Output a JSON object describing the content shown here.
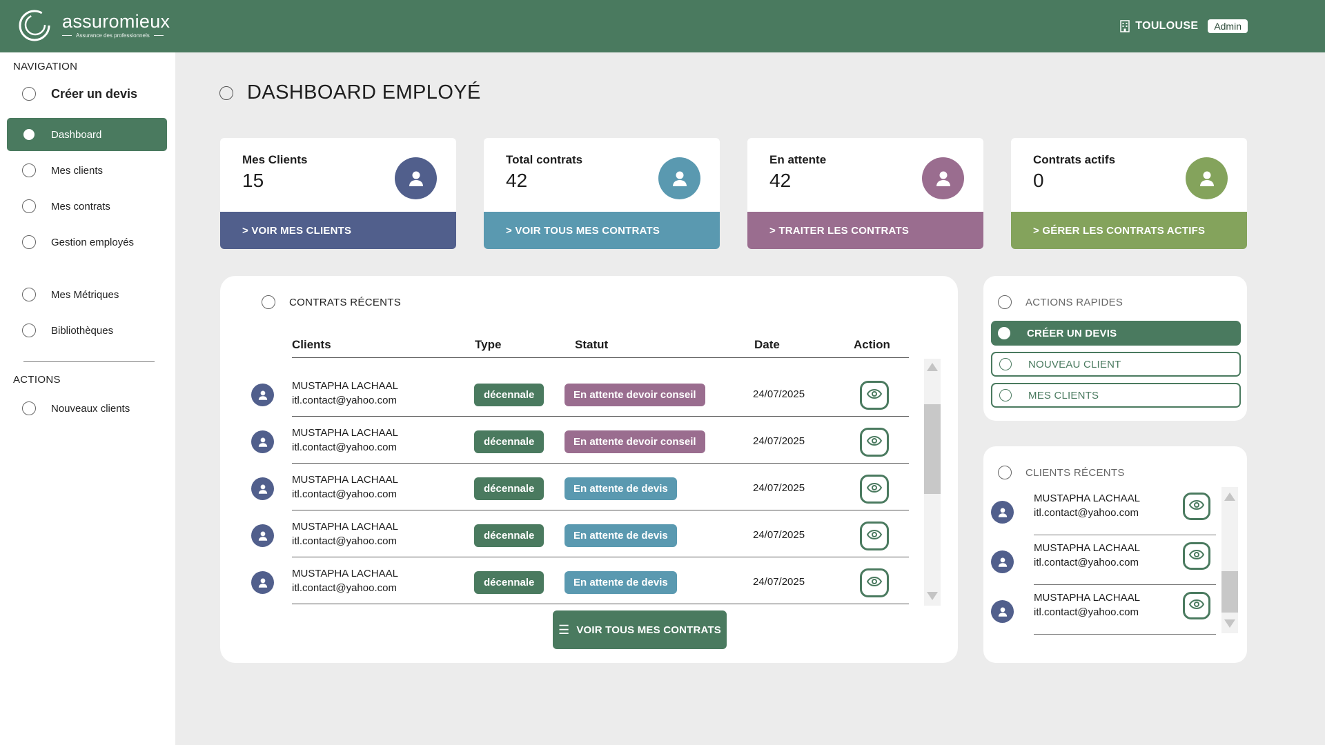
{
  "header": {
    "logo_name": "assuromieux",
    "logo_tagline": "Assurance des professionnels",
    "city": "TOULOUSE",
    "role": "Admin"
  },
  "sidebar": {
    "nav_title": "NAVIGATION",
    "items": [
      {
        "label": "Créer un devis"
      },
      {
        "label": "Dashboard"
      },
      {
        "label": "Mes clients"
      },
      {
        "label": "Mes contrats"
      },
      {
        "label": "Gestion employés"
      },
      {
        "label": "Mes Métriques"
      },
      {
        "label": "Bibliothèques"
      }
    ],
    "actions_title": "ACTIONS",
    "actions": [
      {
        "label": "Nouveaux clients"
      }
    ]
  },
  "main": {
    "title": "DASHBOARD EMPLOYÉ",
    "cards": [
      {
        "label": "Mes Clients",
        "value": "15",
        "link": "> VOIR MES CLIENTS",
        "color": "#515f8c"
      },
      {
        "label": "Total contrats",
        "value": "42",
        "link": "> VOIR TOUS MES CONTRATS",
        "color": "#5a99b0"
      },
      {
        "label": "En attente",
        "value": "42",
        "link": "> TRAITER LES CONTRATS",
        "color": "#9a6d8f"
      },
      {
        "label": "Contrats actifs",
        "value": "0",
        "link": "> GÉRER LES CONTRATS ACTIFS",
        "color": "#84a35c"
      }
    ]
  },
  "contracts": {
    "title": "CONTRATS RÉCENTS",
    "columns": [
      "Clients",
      "Type",
      "Statut",
      "Date",
      "Action"
    ],
    "rows": [
      {
        "name": "MUSTAPHA LACHAAL",
        "email": "itl.contact@yahoo.com",
        "type": "décennale",
        "status": "En attente devoir conseil",
        "status_color": "#9a6d8f",
        "date": "24/07/2025"
      },
      {
        "name": "MUSTAPHA LACHAAL",
        "email": "itl.contact@yahoo.com",
        "type": "décennale",
        "status": "En attente devoir conseil",
        "status_color": "#9a6d8f",
        "date": "24/07/2025"
      },
      {
        "name": "MUSTAPHA LACHAAL",
        "email": "itl.contact@yahoo.com",
        "type": "décennale",
        "status": "En attente de devis",
        "status_color": "#5a99b0",
        "date": "24/07/2025"
      },
      {
        "name": "MUSTAPHA LACHAAL",
        "email": "itl.contact@yahoo.com",
        "type": "décennale",
        "status": "En attente de devis",
        "status_color": "#5a99b0",
        "date": "24/07/2025"
      },
      {
        "name": "MUSTAPHA LACHAAL",
        "email": "itl.contact@yahoo.com",
        "type": "décennale",
        "status": "En attente de devis",
        "status_color": "#5a99b0",
        "date": "24/07/2025"
      }
    ],
    "view_all": "VOIR TOUS MES CONTRATS"
  },
  "quick_actions": {
    "title": "ACTIONS RAPIDES",
    "buttons": [
      {
        "label": "CRÉER UN DEVIS"
      },
      {
        "label": "NOUVEAU CLIENT"
      },
      {
        "label": "MES CLIENTS"
      }
    ]
  },
  "recent_clients": {
    "title": "CLIENTS RÉCENTS",
    "rows": [
      {
        "name": "MUSTAPHA LACHAAL",
        "email": "itl.contact@yahoo.com"
      },
      {
        "name": "MUSTAPHA LACHAAL",
        "email": "itl.contact@yahoo.com"
      },
      {
        "name": "MUSTAPHA LACHAAL",
        "email": "itl.contact@yahoo.com"
      }
    ]
  },
  "colors": {
    "brand": "#4a7a5f",
    "blue_slate": "#515f8c",
    "teal": "#5a99b0",
    "mauve": "#9a6d8f",
    "olive": "#84a35c"
  },
  "icons": {
    "logo": "swirl-logo-icon",
    "city": "building-icon",
    "user": "user-icon",
    "eye": "eye-icon",
    "list": "list-icon"
  }
}
